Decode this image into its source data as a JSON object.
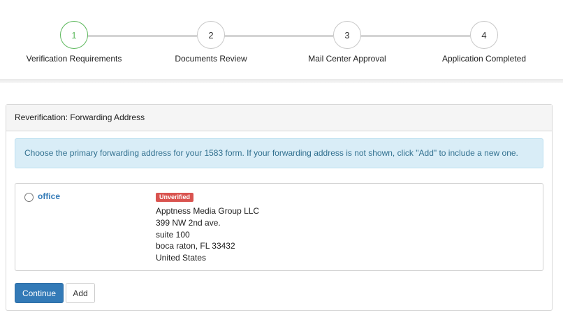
{
  "stepper": {
    "steps": [
      {
        "number": "1",
        "label": "Verification Requirements",
        "active": true
      },
      {
        "number": "2",
        "label": "Documents Review",
        "active": false
      },
      {
        "number": "3",
        "label": "Mail Center Approval",
        "active": false
      },
      {
        "number": "4",
        "label": "Application Completed",
        "active": false
      }
    ]
  },
  "panel": {
    "title": "Reverification: Forwarding Address",
    "info_message": "Choose the primary forwarding address for your 1583 form. If your forwarding address is not shown, click \"Add\" to include a new one.",
    "address": {
      "name": "office",
      "status_badge": "Unverified",
      "company": "Apptness Media Group LLC",
      "line1": "399 NW 2nd ave.",
      "line2": "suite 100",
      "city_state_zip": "boca raton, FL 33432",
      "country": "United States"
    },
    "buttons": {
      "continue_label": "Continue",
      "add_label": "Add"
    }
  },
  "colors": {
    "active_step": "#5cb85c",
    "primary": "#337ab7",
    "info_bg": "#d9edf7",
    "info_text": "#31708f",
    "danger": "#d9534f"
  }
}
